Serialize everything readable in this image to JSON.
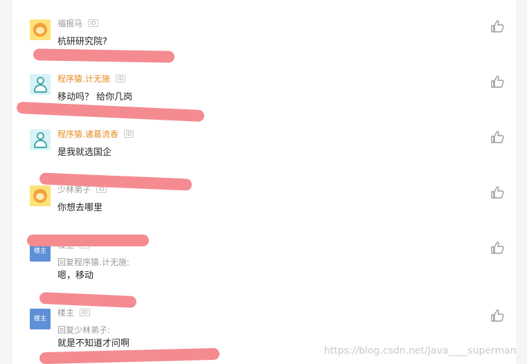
{
  "comments": [
    {
      "username": "福报马",
      "id_badge": "ID",
      "content": "杭研研究院?",
      "avatar": "monkey-avatar"
    },
    {
      "username": "程序猿.计无施",
      "id_badge": "ID",
      "content": "移动吗？ 给你几岗",
      "avatar": "coder-avatar"
    },
    {
      "username": "程序猿.诸葛流香",
      "id_badge": "ID",
      "content": "是我就选国企",
      "avatar": "coder-avatar"
    },
    {
      "username": "少林弟子",
      "id_badge": "ID",
      "content": "你想去哪里",
      "avatar": "monkey-avatar"
    },
    {
      "username": "楼主",
      "id_badge": "ID",
      "reply_to": "回复程序猿.计无施:",
      "content": "嗯，移动",
      "avatar_text": "楼主"
    },
    {
      "username": "楼主",
      "id_badge": "ID",
      "reply_to": "回复少林弟子:",
      "content": "就是不知道才问啊",
      "avatar_text": "楼主"
    }
  ],
  "like_icon": "thumbs-up-icon",
  "colors": {
    "accent_username": "#e58a1f",
    "redaction": "#f48b91"
  },
  "watermark": "https://blog.csdn.net/Java____superman"
}
